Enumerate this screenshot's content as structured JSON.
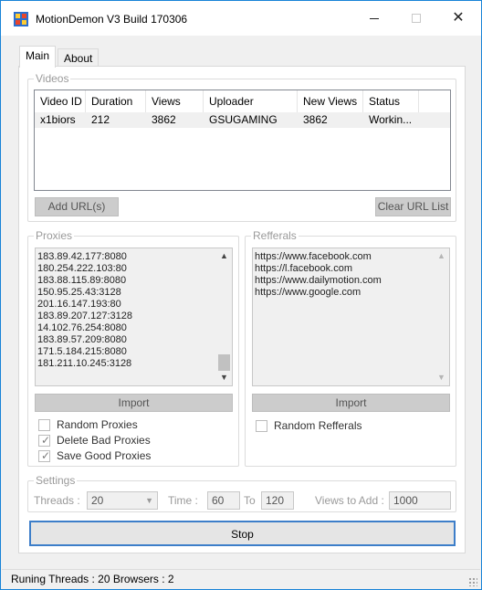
{
  "window": {
    "title": "MotionDemon V3 Build 170306"
  },
  "tabs": [
    {
      "label": "Main"
    },
    {
      "label": "About"
    }
  ],
  "videos": {
    "group_label": "Videos",
    "columns": [
      "Video ID",
      "Duration",
      "Views",
      "Uploader",
      "New Views",
      "Status"
    ],
    "rows": [
      [
        "x1biors",
        "212",
        "3862",
        "GSUGAMING",
        "3862",
        "Workin..."
      ]
    ],
    "add_url_label": "Add URL(s)",
    "clear_url_label": "Clear URL List"
  },
  "proxies": {
    "group_label": "Proxies",
    "items": [
      "183.89.42.177:8080",
      "180.254.222.103:80",
      "183.88.115.89:8080",
      "150.95.25.43:3128",
      "201.16.147.193:80",
      "183.89.207.127:3128",
      "14.102.76.254:8080",
      "183.89.57.209:8080",
      "171.5.184.215:8080",
      "181.211.10.245:3128"
    ],
    "import_label": "Import",
    "random_label": "Random Proxies",
    "random_checked": false,
    "delete_bad_label": "Delete Bad Proxies",
    "delete_bad_checked": true,
    "save_good_label": "Save Good Proxies",
    "save_good_checked": true
  },
  "referrals": {
    "group_label": "Refferals",
    "items": [
      "https://www.facebook.com",
      "https://l.facebook.com",
      "https://www.dailymotion.com",
      "https://www.google.com"
    ],
    "import_label": "Import",
    "random_label": "Random Refferals",
    "random_checked": false
  },
  "settings": {
    "group_label": "Settings",
    "threads_label": "Threads :",
    "threads_value": "20",
    "time_label": "Time :",
    "time_from": "60",
    "to_label": "To",
    "time_to": "120",
    "views_label": "Views to Add :",
    "views_value": "1000"
  },
  "stop_label": "Stop",
  "status": {
    "text": "Runing Threads : 20  Browsers : 2"
  },
  "colors": {
    "accent": "#3d7ec9",
    "title_border": "#1883d7"
  }
}
